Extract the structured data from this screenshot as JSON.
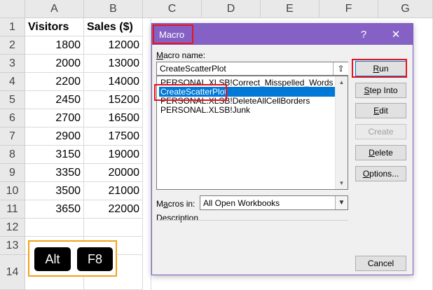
{
  "sheet": {
    "columns": [
      "A",
      "B",
      "C",
      "D",
      "E",
      "F",
      "G"
    ],
    "rows": [
      "1",
      "2",
      "3",
      "4",
      "5",
      "6",
      "7",
      "8",
      "9",
      "10",
      "11",
      "12",
      "13",
      "14"
    ],
    "headers": [
      "Visitors",
      "Sales ($)"
    ],
    "visitors": [
      "1800",
      "2000",
      "2200",
      "2450",
      "2700",
      "2900",
      "3150",
      "3350",
      "3500",
      "3650"
    ],
    "sales": [
      "12000",
      "13000",
      "14000",
      "15200",
      "16500",
      "17500",
      "19000",
      "20000",
      "21000",
      "22000"
    ]
  },
  "keys": {
    "alt": "Alt",
    "f8": "F8"
  },
  "dialog": {
    "title": "Macro",
    "help": "?",
    "close": "✕",
    "macro_name_label_pre": "",
    "macro_name_label_u": "M",
    "macro_name_label_post": "acro name:",
    "macro_name_value": "CreateScatterPlot",
    "up_icon": "⇧",
    "macros": [
      "PERSONAL.XLSB!Correct_Misspelled_Words",
      "CreateScatterPlot",
      "PERSONAL.XLSB!DeleteAllCellBorders",
      "PERSONAL.XLSB!Junk"
    ],
    "buttons": {
      "run_u": "R",
      "run_post": "un",
      "step_u": "S",
      "step_post": "tep Into",
      "edit_u": "E",
      "edit_post": "dit",
      "create": "Create",
      "delete_u": "D",
      "delete_post": "elete",
      "options_u": "O",
      "options_post": "ptions...",
      "cancel": "Cancel"
    },
    "macros_in_label_pre": "M",
    "macros_in_label_u": "a",
    "macros_in_label_post": "cros in:",
    "macros_in_value": "All Open Workbooks",
    "description_label": "Description",
    "highlight_color": "#e8141b",
    "title_color": "#8661c5"
  }
}
